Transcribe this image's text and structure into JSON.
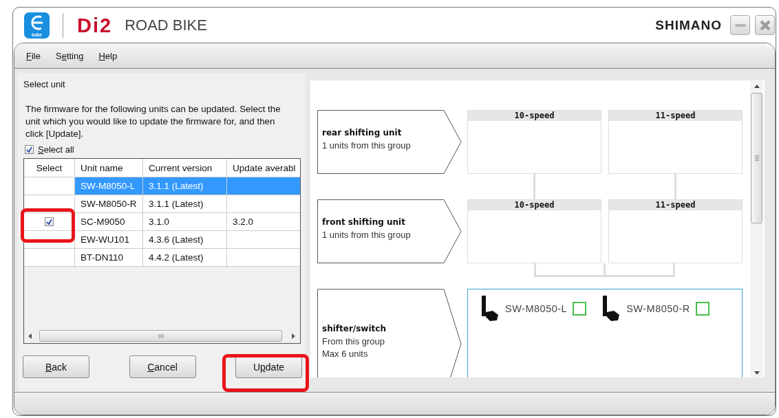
{
  "header": {
    "logo_text": "tube",
    "brand": "Di2",
    "title": "ROAD BIKE",
    "maker": "SHIMANO"
  },
  "menu": [
    {
      "key": "F",
      "after": "ile"
    },
    {
      "before": "S",
      "key": "e",
      "after": "tting"
    },
    {
      "key": "H",
      "after": "elp"
    }
  ],
  "panel": {
    "heading": "Select unit",
    "message": "The firmware for the following units can be updated. Select the unit which you would like to update the firmware for, and then click [Update].",
    "select_all": {
      "key": "S",
      "after": "elect all",
      "checked": true
    }
  },
  "table": {
    "columns": [
      "Select",
      "Unit name",
      "Current version",
      "Update averabl"
    ],
    "rows": [
      {
        "selected": true,
        "checked": false,
        "unit": "SW-M8050-L",
        "current_version": "3.1.1 (Latest)"
      },
      {
        "selected": false,
        "checked": false,
        "unit": "SW-M8050-R",
        "current_version": "3.1.1 (Latest)"
      },
      {
        "selected": false,
        "checked": true,
        "unit": "SC-M9050",
        "current_version": "3.1.0",
        "update_available": "3.2.0"
      },
      {
        "selected": false,
        "checked": false,
        "unit": "EW-WU101",
        "current_version": "4.3.6 (Latest)"
      },
      {
        "selected": false,
        "checked": false,
        "unit": "BT-DN110",
        "current_version": "4.4.2 (Latest)"
      }
    ]
  },
  "buttons": [
    {
      "key": "B",
      "after": "ack"
    },
    {
      "key": "C",
      "after": "ancel"
    },
    {
      "before": "U",
      "key": "p",
      "after": "date"
    }
  ],
  "diagram": {
    "groups": [
      {
        "kind": "speeds",
        "title": "rear shifting unit",
        "lines": [
          "1 units from this group"
        ],
        "slots": [
          "10-speed",
          "11-speed"
        ]
      },
      {
        "kind": "speeds",
        "title": "front shifting unit",
        "lines": [
          "1 units from this group"
        ],
        "slots": [
          "10-speed",
          "11-speed"
        ]
      },
      {
        "kind": "units",
        "title": "shifter/switch",
        "lines": [
          "From this group",
          "Max 6 units"
        ],
        "units": [
          {
            "name": "SW-M8050-L",
            "checked": false
          },
          {
            "name": "SW-M8050-R",
            "checked": false
          }
        ]
      }
    ]
  }
}
